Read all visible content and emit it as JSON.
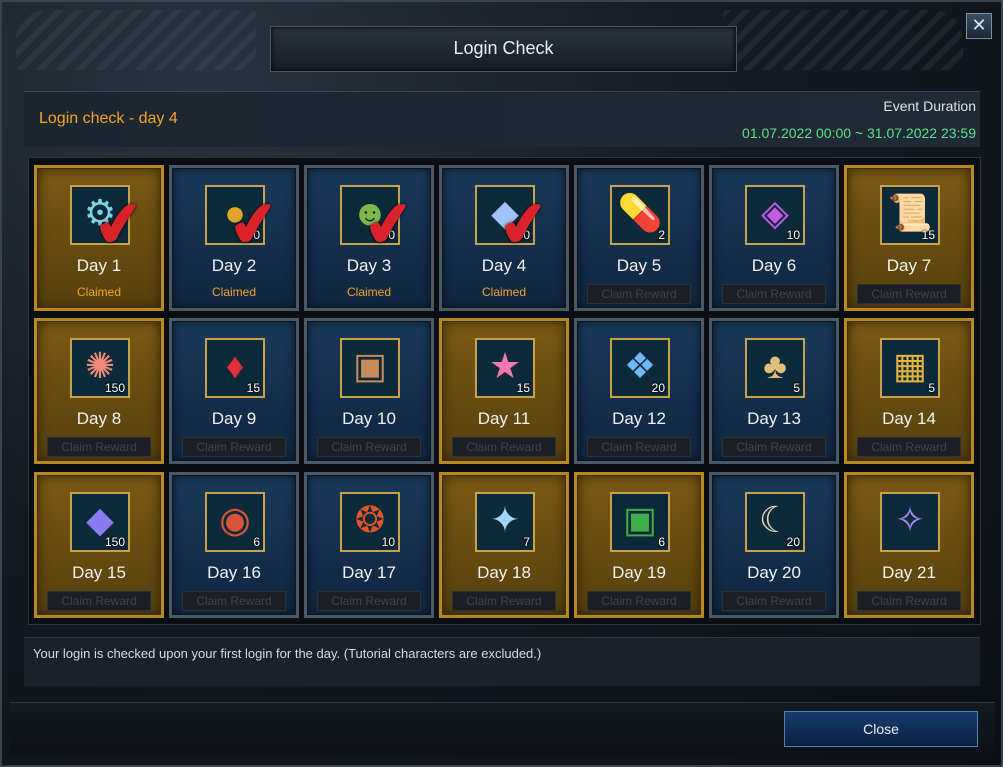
{
  "window": {
    "title": "Login Check"
  },
  "header": {
    "login_day": "Login check - day 4",
    "event_duration_label": "Event Duration",
    "event_range": "01.07.2022 00:00 ~ 31.07.2022 23:59"
  },
  "days": [
    {
      "label": "Day 1",
      "qty": "",
      "status": "Claimed",
      "claimed": true,
      "gold": true,
      "icon": "clock-icon",
      "glyph": "⚙",
      "color": "#7fd3e0"
    },
    {
      "label": "Day 2",
      "qty": "100",
      "status": "Claimed",
      "claimed": true,
      "gold": false,
      "icon": "gold-gem-icon",
      "glyph": "●",
      "color": "#e0a62a"
    },
    {
      "label": "Day 3",
      "qty": "100",
      "status": "Claimed",
      "claimed": true,
      "gold": false,
      "icon": "frog-icon",
      "glyph": "☻",
      "color": "#7fb84a"
    },
    {
      "label": "Day 4",
      "qty": "150",
      "status": "Claimed",
      "claimed": true,
      "gold": false,
      "icon": "diamond-icon",
      "glyph": "◆",
      "color": "#9fc3f5"
    },
    {
      "label": "Day 5",
      "qty": "2",
      "status": "Claim Reward",
      "claimed": false,
      "gold": false,
      "icon": "capsule-icon",
      "glyph": "💊",
      "color": "#8fd7f0"
    },
    {
      "label": "Day 6",
      "qty": "10",
      "status": "Claim Reward",
      "claimed": false,
      "gold": false,
      "icon": "rainbow-gem-icon",
      "glyph": "◈",
      "color": "#c45be8"
    },
    {
      "label": "Day 7",
      "qty": "15",
      "status": "Claim Reward",
      "claimed": false,
      "gold": true,
      "icon": "scroll-icon",
      "glyph": "📜",
      "color": "#d9d2bf"
    },
    {
      "label": "Day 8",
      "qty": "150",
      "status": "Claim Reward",
      "claimed": false,
      "gold": true,
      "icon": "coral-icon",
      "glyph": "✺",
      "color": "#f08a7a"
    },
    {
      "label": "Day 9",
      "qty": "15",
      "status": "Claim Reward",
      "claimed": false,
      "gold": false,
      "icon": "red-crystal-icon",
      "glyph": "♦",
      "color": "#e0313a"
    },
    {
      "label": "Day 10",
      "qty": "",
      "status": "Claim Reward",
      "claimed": false,
      "gold": false,
      "icon": "gift-box-icon",
      "glyph": "▣",
      "color": "#c98a5a"
    },
    {
      "label": "Day 11",
      "qty": "15",
      "status": "Claim Reward",
      "claimed": false,
      "gold": true,
      "icon": "star-icon",
      "glyph": "★",
      "color": "#f27ab0"
    },
    {
      "label": "Day 12",
      "qty": "20",
      "status": "Claim Reward",
      "claimed": false,
      "gold": false,
      "icon": "blue-crystals-icon",
      "glyph": "❖",
      "color": "#6fb7f5"
    },
    {
      "label": "Day 13",
      "qty": "5",
      "status": "Claim Reward",
      "claimed": false,
      "gold": false,
      "icon": "pouch-icon",
      "glyph": "♣",
      "color": "#e0c07a"
    },
    {
      "label": "Day 14",
      "qty": "5",
      "status": "Claim Reward",
      "claimed": false,
      "gold": true,
      "icon": "treasure-chest-icon",
      "glyph": "▦",
      "color": "#e6b43a"
    },
    {
      "label": "Day 15",
      "qty": "150",
      "status": "Claim Reward",
      "claimed": false,
      "gold": true,
      "icon": "purple-diamond-icon",
      "glyph": "◆",
      "color": "#8a7cf0"
    },
    {
      "label": "Day 16",
      "qty": "6",
      "status": "Claim Reward",
      "claimed": false,
      "gold": false,
      "icon": "red-core-icon",
      "glyph": "◉",
      "color": "#d9553a"
    },
    {
      "label": "Day 17",
      "qty": "10",
      "status": "Claim Reward",
      "claimed": false,
      "gold": false,
      "icon": "fire-orb-icon",
      "glyph": "❂",
      "color": "#e0552a"
    },
    {
      "label": "Day 18",
      "qty": "7",
      "status": "Claim Reward",
      "claimed": false,
      "gold": true,
      "icon": "amulet-icon",
      "glyph": "✦",
      "color": "#9fd7f0"
    },
    {
      "label": "Day 19",
      "qty": "6",
      "status": "Claim Reward",
      "claimed": false,
      "gold": true,
      "icon": "green-gift-icon",
      "glyph": "▣",
      "color": "#3fae4a"
    },
    {
      "label": "Day 20",
      "qty": "20",
      "status": "Claim Reward",
      "claimed": false,
      "gold": false,
      "icon": "rune-stone-icon",
      "glyph": "☾",
      "color": "#e6dcc0"
    },
    {
      "label": "Day 21",
      "qty": "",
      "status": "Claim Reward",
      "claimed": false,
      "gold": true,
      "icon": "card-icon",
      "glyph": "✧",
      "color": "#a58cf0"
    }
  ],
  "note": "Your login is checked upon your first login for the day. (Tutorial characters are excluded.)",
  "footer": {
    "close_label": "Close"
  },
  "close_x_glyph": "✕"
}
